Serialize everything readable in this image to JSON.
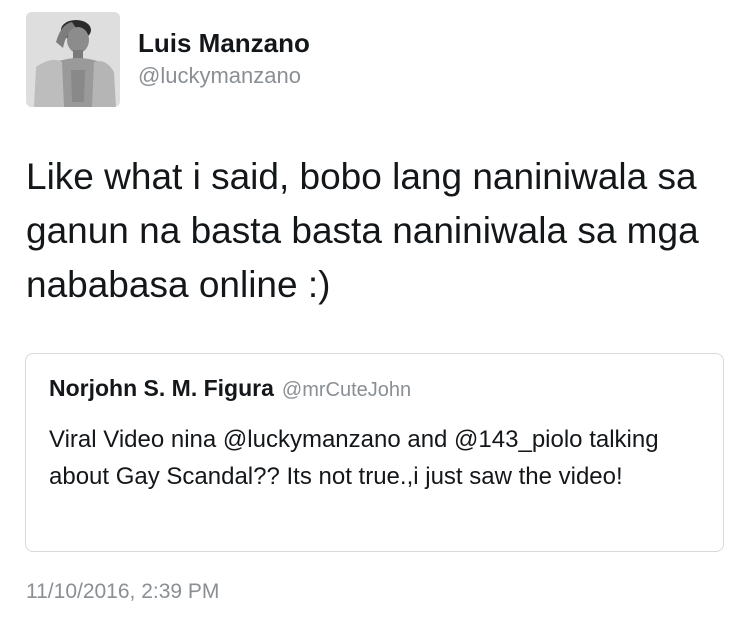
{
  "author": {
    "display_name": "Luis Manzano",
    "handle": "@luckymanzano"
  },
  "tweet": {
    "text": "Like what i said, bobo lang naniniwala sa ganun na basta basta naniniwala sa mga nababasa online :)",
    "timestamp": "11/10/2016, 2:39 PM"
  },
  "quoted_tweet": {
    "display_name": "Norjohn S. M. Figura",
    "handle": "@mrCuteJohn",
    "text": "Viral Video nina @luckymanzano and @143_piolo talking about Gay Scandal?? Its not true.,i just saw the video!"
  },
  "colors": {
    "primary_text": "#14171a",
    "secondary_text": "#8a8f94",
    "card_border": "#d6dadd"
  }
}
